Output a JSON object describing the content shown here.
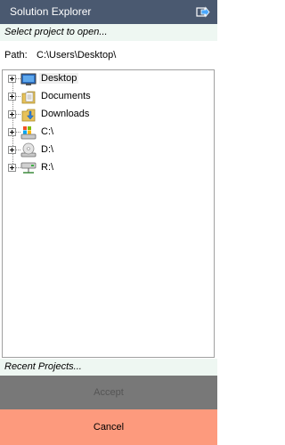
{
  "window": {
    "title": "Solution Explorer"
  },
  "hint": "Select project to open...",
  "path": {
    "label": "Path:",
    "value": "C:\\Users\\Desktop\\"
  },
  "tree": {
    "items": [
      {
        "label": "Desktop",
        "icon": "desktop-icon",
        "selected": true
      },
      {
        "label": "Documents",
        "icon": "documents-icon"
      },
      {
        "label": "Downloads",
        "icon": "downloads-icon"
      },
      {
        "label": "C:\\",
        "icon": "system-drive-icon"
      },
      {
        "label": "D:\\",
        "icon": "cd-drive-icon"
      },
      {
        "label": "R:\\",
        "icon": "network-drive-icon"
      }
    ]
  },
  "recent": "Recent Projects...",
  "buttons": {
    "accept": "Accept",
    "cancel": "Cancel"
  },
  "colors": {
    "titlebar": "#4a5970",
    "hintbar": "#eef7f2",
    "accept_bg": "#787878",
    "cancel_bg": "#fd9a7d"
  }
}
